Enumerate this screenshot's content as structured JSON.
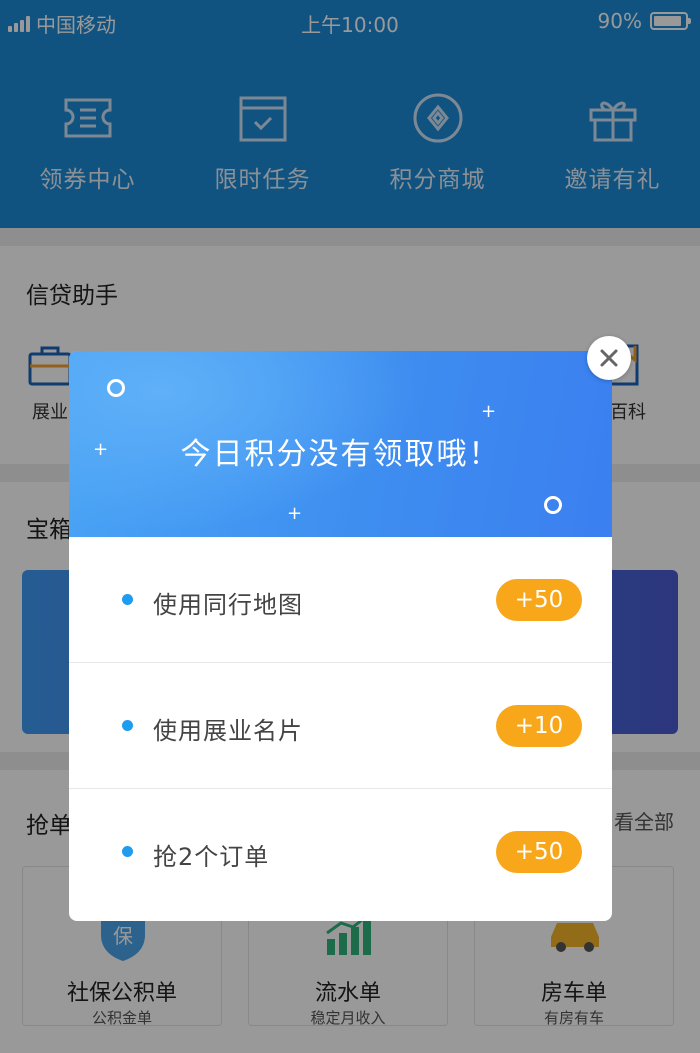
{
  "status_bar": {
    "carrier": "中国移动",
    "time": "上午10:00",
    "battery": "90%",
    "battery_level": 0.9
  },
  "quick_nav": [
    {
      "label": "领券中心",
      "icon": "ticket-icon"
    },
    {
      "label": "限时任务",
      "icon": "calendar-check-icon"
    },
    {
      "label": "积分商城",
      "icon": "diamond-circle-icon"
    },
    {
      "label": "邀请有礼",
      "icon": "gift-icon"
    }
  ],
  "assistant": {
    "title": "信贷助手",
    "items": [
      {
        "label": "展业",
        "icon": "briefcase-icon"
      },
      {
        "label": "贷百科",
        "icon": "book-icon"
      }
    ]
  },
  "treasure": {
    "title": "宝箱"
  },
  "orders": {
    "title": "抢单",
    "view_all": "看全部",
    "cards": [
      {
        "title": "社保公积单",
        "sub": "公积金单",
        "icon": "shield-icon",
        "badge": "保"
      },
      {
        "title": "流水单",
        "sub": "稳定月收入",
        "icon": "bar-chart-icon"
      },
      {
        "title": "房车单",
        "sub": "有房有车",
        "icon": "car-icon"
      }
    ]
  },
  "modal": {
    "title": "今日积分没有领取哦！",
    "tasks": [
      {
        "label": "使用同行地图",
        "points": "+50"
      },
      {
        "label": "使用展业名片",
        "points": "+10"
      },
      {
        "label": "抢2个订单",
        "points": "+50"
      }
    ]
  },
  "colors": {
    "header": "#1d8ad6",
    "accent": "#1e9cf0",
    "points_badge": "#f8a71a",
    "modal_head": "#3e8ef0"
  }
}
